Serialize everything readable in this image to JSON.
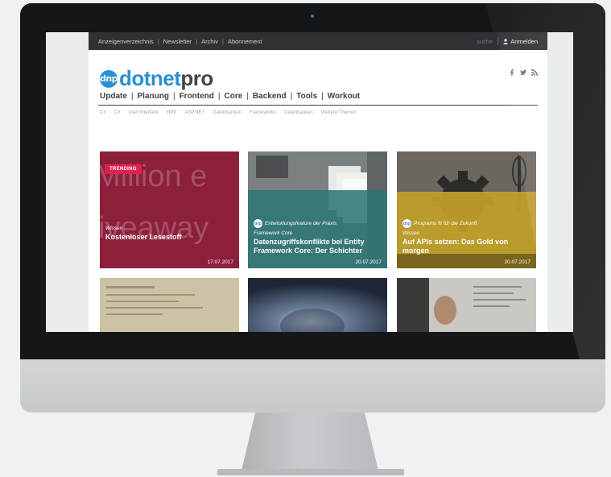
{
  "topbar": {
    "links": [
      "Anzeigenverzeichnis",
      "Newsletter",
      "Archiv",
      "Abonnement"
    ],
    "search_label": "suche",
    "login_label": "Anmelden"
  },
  "logo": {
    "badge": "dnp",
    "part1": "dotnet",
    "part2": "pro"
  },
  "main_nav": [
    "Update",
    "Planung",
    "Frontend",
    "Core",
    "Backend",
    "Tools",
    "Workout"
  ],
  "sub_nav": [
    "C#",
    "C#",
    "User Interface",
    "HPP",
    "ASP.NET",
    "Datenbanken",
    "Frameworks",
    "Datenbanken",
    "Weitere Themen"
  ],
  "tiles": [
    {
      "badge": "TRENDING",
      "bg_words": [
        "Million e",
        "iveaway"
      ],
      "category": "Wissen",
      "title": "Kostenloser Lesestoff",
      "date": "17.07.2017"
    },
    {
      "pill_label": "Entwicklungsfeature der Praxis",
      "category": "Framework Core",
      "title": "Datenzugriffskonflikte bei Entity Framework Core: Der Schichter",
      "date": "20.07.2017"
    },
    {
      "pill_label": "Programs fit für die Zukunft",
      "category": "Wissen",
      "title": "Auf APIs setzen: Das Gold von morgen",
      "date": "20.07.2017"
    }
  ],
  "colors": {
    "brand_blue": "#2c8fd1",
    "topbar": "#2f3235",
    "trending": "#e0214f",
    "tile_red": "#8c1f3a",
    "tile_teal": "#2e7674",
    "tile_gold": "#c2a028"
  },
  "icons": [
    "user-icon",
    "facebook-icon",
    "twitter-icon",
    "rss-icon"
  ]
}
